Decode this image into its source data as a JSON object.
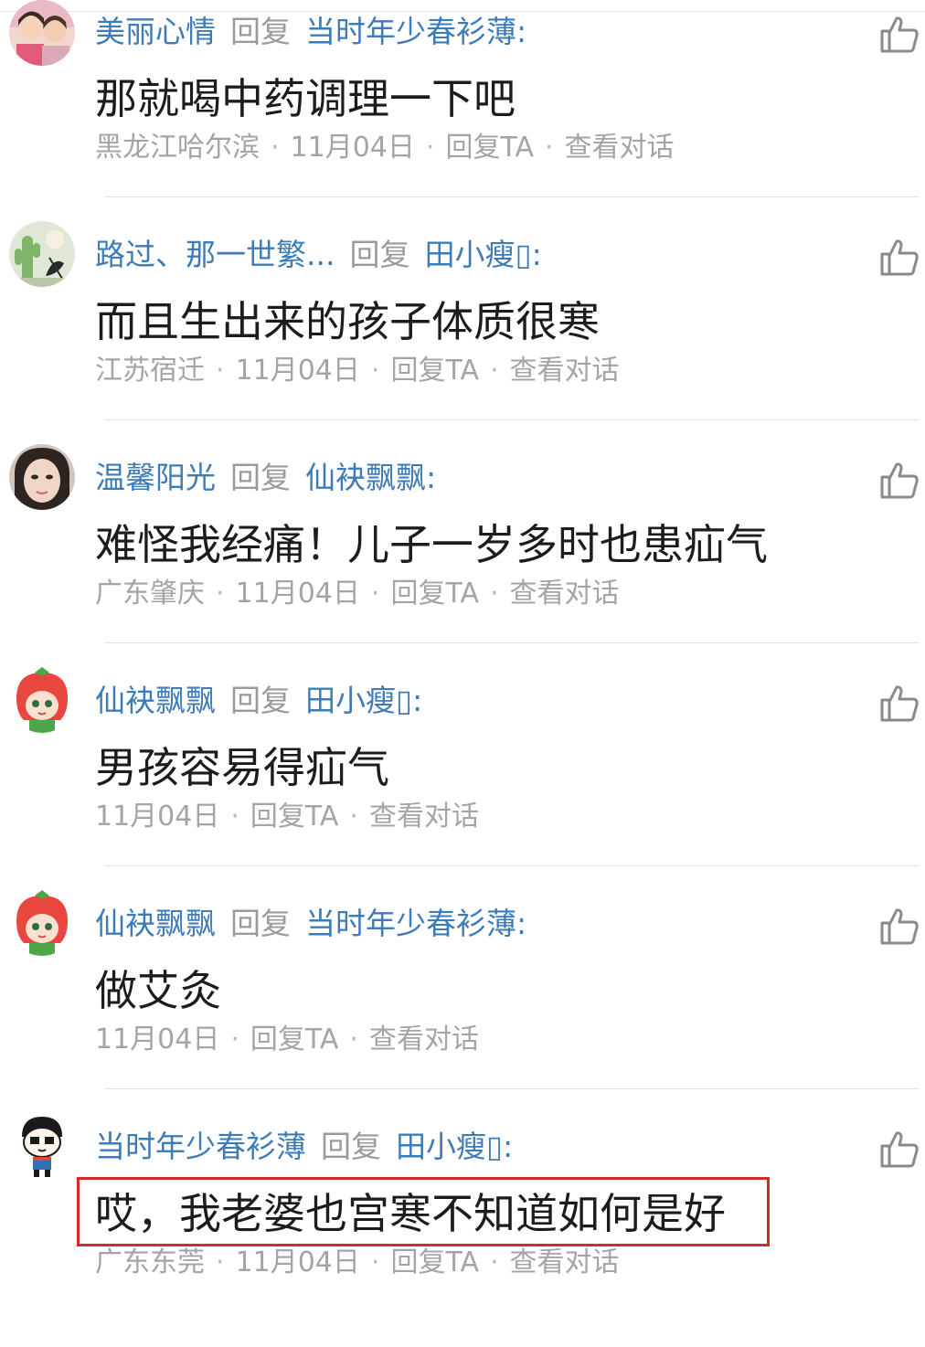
{
  "reply_word": "回复",
  "colon": ":",
  "separator": "·",
  "comments": [
    {
      "username": "美丽心情",
      "reply_to": "当时年少春衫薄",
      "text": "那就喝中药调理一下吧",
      "location": "黑龙江哈尔滨",
      "date": "11月04日",
      "reply_label": "回复TA",
      "view_label": "查看对话",
      "avatar_icon": "two-women-photo-avatar"
    },
    {
      "username": "路过、那一世繁...",
      "reply_to": "田小瘦▯",
      "text": "而且生出来的孩子体质很寒",
      "location": "江苏宿迁",
      "date": "11月04日",
      "reply_label": "回复TA",
      "view_label": "查看对话",
      "avatar_icon": "cactus-painting-avatar"
    },
    {
      "username": "温馨阳光",
      "reply_to": "仙袂飘飘",
      "text": "难怪我经痛！儿子一岁多时也患疝气",
      "location": "广东肇庆",
      "date": "11月04日",
      "reply_label": "回复TA",
      "view_label": "查看对话",
      "avatar_icon": "woman-face-photo-avatar"
    },
    {
      "username": "仙袂飘飘",
      "reply_to": "田小瘦▯",
      "text": "男孩容易得疝气",
      "location": "",
      "date": "11月04日",
      "reply_label": "回复TA",
      "view_label": "查看对话",
      "avatar_icon": "strawberry-girl-avatar"
    },
    {
      "username": "仙袂飘飘",
      "reply_to": "当时年少春衫薄",
      "text": "做艾灸",
      "location": "",
      "date": "11月04日",
      "reply_label": "回复TA",
      "view_label": "查看对话",
      "avatar_icon": "strawberry-girl-avatar"
    },
    {
      "username": "当时年少春衫薄",
      "reply_to": "田小瘦▯",
      "text": "哎，我老婆也宫寒不知道如何是好",
      "location": "广东东莞",
      "date": "11月04日",
      "reply_label": "回复TA",
      "view_label": "查看对话",
      "avatar_icon": "cartoon-boy-avatar"
    }
  ],
  "colors": {
    "username": "#3e7cb8",
    "meta": "#a4a4a4",
    "body": "#1c1c1c",
    "highlight": "#d42a2a"
  }
}
